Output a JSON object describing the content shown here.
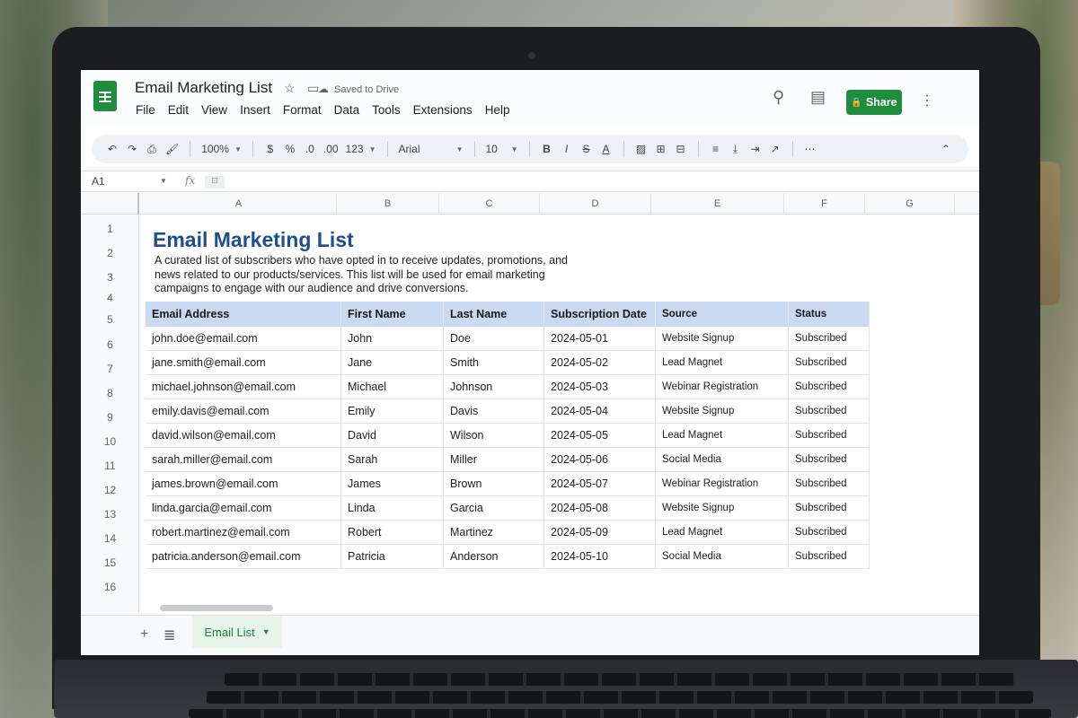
{
  "app": {
    "title": "Email Marketing List",
    "saved_status": "Saved to Drive",
    "share_label": "Share"
  },
  "menu": [
    "File",
    "Edit",
    "View",
    "Insert",
    "Format",
    "Data",
    "Tools",
    "Extensions",
    "Help"
  ],
  "toolbar": {
    "zoom": "100%",
    "currency": "$",
    "percent": "%",
    "decrease_decimal": ".0",
    "increase_decimal": ".00",
    "number_format": "123",
    "font": "Arial",
    "font_size": "10",
    "more": "⋯"
  },
  "formula_bar": {
    "cell_ref": "A1",
    "fx": "fx"
  },
  "columns": [
    "A",
    "B",
    "C",
    "D",
    "E",
    "F",
    "G"
  ],
  "rows": [
    "1",
    "2",
    "3",
    "4",
    "5",
    "6",
    "7",
    "8",
    "9",
    "10",
    "11",
    "12",
    "13",
    "14",
    "15",
    "16"
  ],
  "sheet": {
    "title": "Email Marketing List",
    "description": "A curated list of subscribers who have opted in to receive updates, promotions, and news related to our products/services. This list will be used for email marketing campaigns to engage with our audience and drive conversions.",
    "headers": [
      "Email Address",
      "First Name",
      "Last Name",
      "Subscription Date",
      "Source",
      "Status"
    ],
    "records": [
      [
        "john.doe@email.com",
        "John",
        "Doe",
        "2024-05-01",
        "Website Signup",
        "Subscribed"
      ],
      [
        "jane.smith@email.com",
        "Jane",
        "Smith",
        "2024-05-02",
        "Lead Magnet",
        "Subscribed"
      ],
      [
        "michael.johnson@email.com",
        "Michael",
        "Johnson",
        "2024-05-03",
        "Webinar Registration",
        "Subscribed"
      ],
      [
        "emily.davis@email.com",
        "Emily",
        "Davis",
        "2024-05-04",
        "Website Signup",
        "Subscribed"
      ],
      [
        "david.wilson@email.com",
        "David",
        "Wilson",
        "2024-05-05",
        "Lead Magnet",
        "Subscribed"
      ],
      [
        "sarah.miller@email.com",
        "Sarah",
        "Miller",
        "2024-05-06",
        "Social Media",
        "Subscribed"
      ],
      [
        "james.brown@email.com",
        "James",
        "Brown",
        "2024-05-07",
        "Webinar Registration",
        "Subscribed"
      ],
      [
        "linda.garcia@email.com",
        "Linda",
        "Garcia",
        "2024-05-08",
        "Website Signup",
        "Subscribed"
      ],
      [
        "robert.martinez@email.com",
        "Robert",
        "Martinez",
        "2024-05-09",
        "Lead Magnet",
        "Subscribed"
      ],
      [
        "patricia.anderson@email.com",
        "Patricia",
        "Anderson",
        "2024-05-10",
        "Social Media",
        "Subscribed"
      ]
    ]
  },
  "tabs": {
    "active": "Email List"
  },
  "colors": {
    "brand_green": "#1e8e3e",
    "title_blue": "#1f4e8c",
    "header_fill": "#c9d9ef"
  }
}
